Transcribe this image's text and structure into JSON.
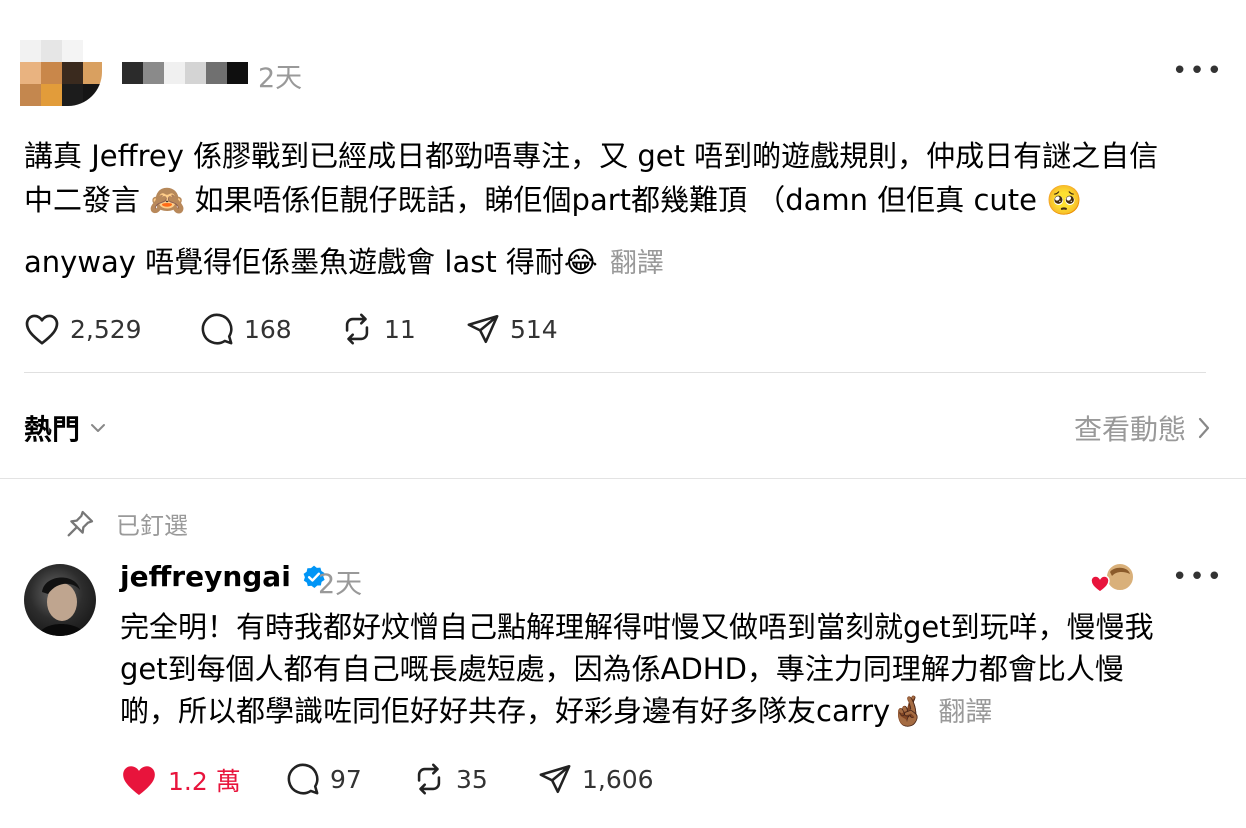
{
  "post": {
    "time": "2天",
    "line1": "講真 Jeffrey 係膠戰到已經成日都勁唔專注，又 get 唔到啲遊戲規則，仲成日有謎之自信",
    "line2": "中二發言 🙈 如果唔係佢靚仔既話，睇佢個part都幾難頂 （damn 但佢真 cute 🥺",
    "line3": "anyway 唔覺得佢係墨魚遊戲會 last 得耐😂",
    "translate_label": "翻譯",
    "stats": {
      "likes": "2,529",
      "comments": "168",
      "reposts": "11",
      "shares": "514"
    }
  },
  "replies_header": {
    "sort_label": "熱門",
    "activity_label": "查看動態"
  },
  "reply": {
    "pinned_label": "已釘選",
    "username": "jeffreyngai",
    "time": "2天",
    "line1": "完全明！有時我都好炆憎自己點解理解得咁慢又做唔到當刻就get到玩咩，慢慢我",
    "line2": "get到每個人都有自己嘅長處短處，因為係ADHD，專注力同理解力都會比人慢",
    "line3": "啲，所以都學識咗同佢好好共存，好彩身邊有好多隊友carry🤞🏾",
    "translate_label": "翻譯",
    "stats": {
      "likes": "1.2 萬",
      "comments": "97",
      "reposts": "35",
      "shares": "1,606"
    }
  },
  "icons": [
    "heart-icon",
    "comment-icon",
    "repost-icon",
    "share-icon",
    "more-icon",
    "chevron-down-icon",
    "chevron-right-icon",
    "pin-icon",
    "verified-badge-icon"
  ],
  "colors": {
    "like_active": "#e8143c",
    "verified": "#0095f6",
    "muted_text": "#999999"
  }
}
